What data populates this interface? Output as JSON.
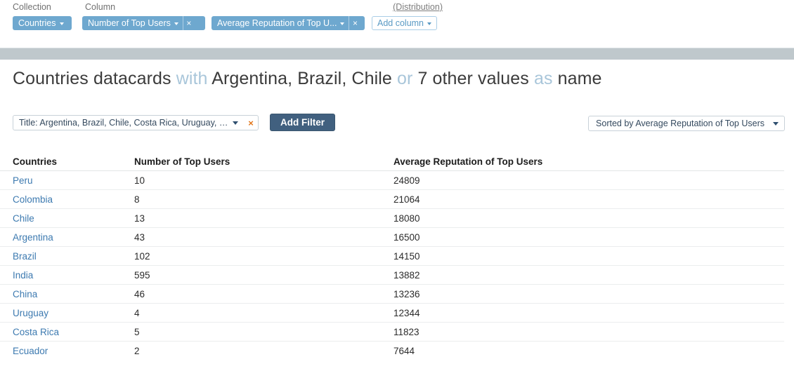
{
  "topbar": {
    "collection_label": "Collection",
    "column_label": "Column",
    "distribution_link": "(Distribution)",
    "collection_chip": "Countries",
    "column_chips": [
      {
        "label": "Number of Top Users",
        "close": "×"
      },
      {
        "label": "Average Reputation of Top U...",
        "close": "×"
      }
    ],
    "add_column_label": "Add column"
  },
  "headline": {
    "part1": "Countries datacards",
    "conn1": "with",
    "part2": "Argentina, Brazil, Chile",
    "conn2": "or",
    "part3": "7 other values",
    "conn3": "as",
    "part4": "name"
  },
  "filterbar": {
    "filter_chip": "Title: Argentina, Brazil, Chile, Costa Rica, Uruguay, In...",
    "filter_close": "×",
    "add_filter_label": "Add Filter",
    "sort_label": "Sorted by Average Reputation of Top Users"
  },
  "table": {
    "columns": [
      "Countries",
      "Number of Top Users",
      "Average Reputation of Top Users"
    ],
    "rows": [
      {
        "country": "Peru",
        "users": "10",
        "reputation": "24809"
      },
      {
        "country": "Colombia",
        "users": "8",
        "reputation": "21064"
      },
      {
        "country": "Chile",
        "users": "13",
        "reputation": "18080"
      },
      {
        "country": "Argentina",
        "users": "43",
        "reputation": "16500"
      },
      {
        "country": "Brazil",
        "users": "102",
        "reputation": "14150"
      },
      {
        "country": "India",
        "users": "595",
        "reputation": "13882"
      },
      {
        "country": "China",
        "users": "46",
        "reputation": "13236"
      },
      {
        "country": "Uruguay",
        "users": "4",
        "reputation": "12344"
      },
      {
        "country": "Costa Rica",
        "users": "5",
        "reputation": "11823"
      },
      {
        "country": "Ecuador",
        "users": "2",
        "reputation": "7644"
      }
    ]
  },
  "colors": {
    "chip_blue": "#6ea8cf",
    "accent_dark": "#41607f",
    "link_blue": "#3d7ab0",
    "connector_blue": "#a9c6da",
    "close_orange": "#e2761b",
    "band_gray": "#bfc8cc"
  }
}
